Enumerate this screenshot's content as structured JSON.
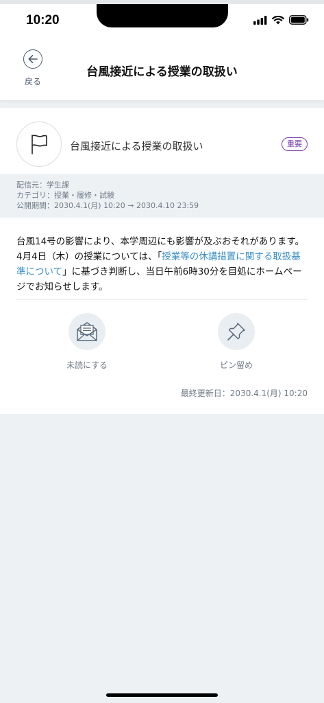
{
  "status": {
    "time": "10:20"
  },
  "header": {
    "back_label": "戻る",
    "title": "台風接近による授業の取扱い"
  },
  "notice": {
    "title": "台風接近による授業の取扱い",
    "badge": "重要",
    "meta": {
      "sender": "配信元：学生課",
      "category": "カテゴリ：授業・履修・試験",
      "period": "公開期間：2030.4.1(月) 10:20 → 2030.4.10 23:59"
    },
    "body": {
      "part1": "台風14号の影響により、本学周辺にも影響が及ぶおそれがあります。4月4日（木）の授業については、「",
      "link": "授業等の休講措置に関する取扱基準について",
      "part2": "」に基づき判断し、当日午前6時30分を目処にホームページでお知らせします。"
    },
    "actions": {
      "mark_unread": "未読にする",
      "pin": "ピン留め"
    },
    "updated": "最終更新日：2030.4.1(月) 10:20"
  },
  "colors": {
    "badge": "#7a3fb0",
    "link": "#3a8fc7",
    "background": "#edf1f4"
  }
}
